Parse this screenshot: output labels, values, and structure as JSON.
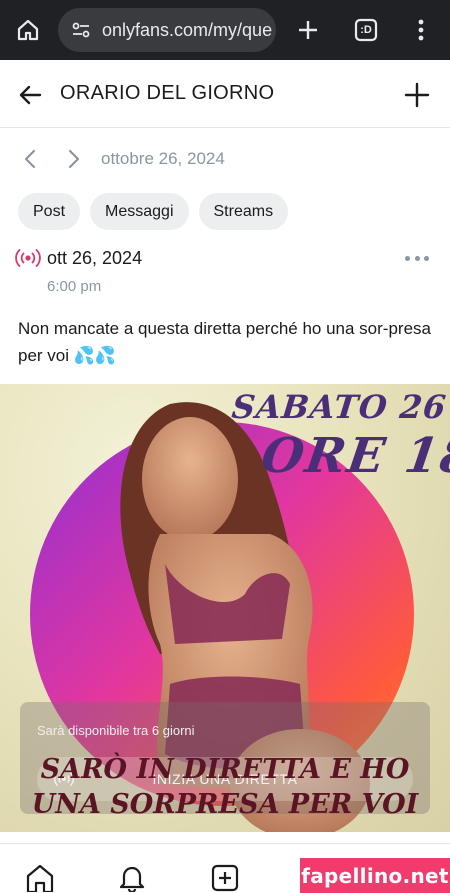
{
  "browser": {
    "url": "onlyfans.com/my/que",
    "tab_count_label": ":D"
  },
  "header": {
    "title": "ORARIO DEL GIORNO"
  },
  "date_nav": {
    "date": "ottobre 26, 2024"
  },
  "chips": [
    {
      "label": "Post"
    },
    {
      "label": "Messaggi"
    },
    {
      "label": "Streams"
    }
  ],
  "post": {
    "date": "ott 26, 2024",
    "time": "6:00 pm",
    "text": "Non mancate a questa diretta perché ho una sor-presa per voi 💦💦",
    "image": {
      "line1": "SABATO 26",
      "line2": "ORE 18",
      "bottom_line1": "SARÒ IN DIRETTA E HO",
      "bottom_line2": "UNA SORPRESA PER VOI"
    },
    "overlay": {
      "availability": "Sarà disponibile tra 6 giorni",
      "start_label": "INIZIA UNA DIRETTA"
    }
  },
  "watermark": "fapellino.net",
  "colors": {
    "accent_live": "#d83a6a",
    "muted": "#8a96a3",
    "browser_bg": "#202124",
    "watermark_bg": "#f03b6c",
    "image_text_purple": "#4b2e78",
    "image_text_maroon": "#5a1424"
  }
}
